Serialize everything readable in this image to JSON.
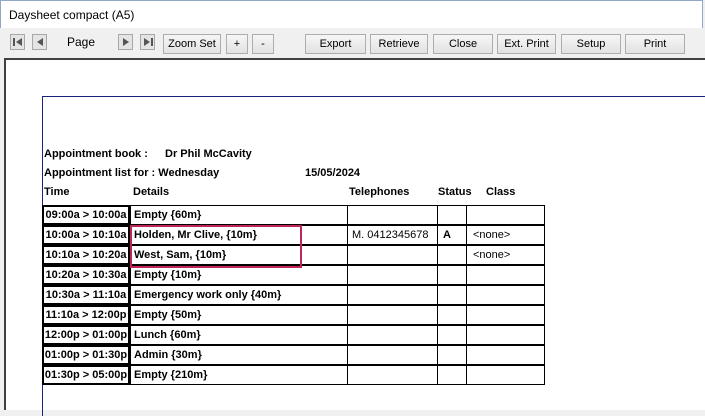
{
  "window": {
    "title": "Daysheet compact (A5)"
  },
  "toolbar": {
    "page_label": "Page",
    "zoom_set": "Zoom Set",
    "zoom_in": "+",
    "zoom_out": "-",
    "export": "Export",
    "retrieve": "Retrieve",
    "close": "Close",
    "ext_print": "Ext. Print",
    "setup": "Setup",
    "print": "Print"
  },
  "report": {
    "book_label": "Appointment book :",
    "book_value": "Dr Phil McCavity",
    "list_label": "Appointment list for : Wednesday",
    "date": "15/05/2024",
    "headers": {
      "time": "Time",
      "details": "Details",
      "telephones": "Telephones",
      "status": "Status",
      "class": "Class"
    },
    "rows": [
      {
        "time": "09:00a > 10:00a",
        "details": "Empty {60m}",
        "telephone": "",
        "status": "",
        "class": ""
      },
      {
        "time": "10:00a > 10:10a",
        "details": "Holden, Mr Clive,  {10m}",
        "telephone": "M. 0412345678",
        "status": "A",
        "class": "<none>"
      },
      {
        "time": "10:10a > 10:20a",
        "details": "West, Sam,  {10m}",
        "telephone": "",
        "status": "",
        "class": "<none>"
      },
      {
        "time": "10:20a > 10:30a",
        "details": "Empty {10m}",
        "telephone": "",
        "status": "",
        "class": ""
      },
      {
        "time": "10:30a > 11:10a",
        "details": "Emergency work only {40m}",
        "telephone": "",
        "status": "",
        "class": ""
      },
      {
        "time": "11:10a > 12:00p",
        "details": "Empty {50m}",
        "telephone": "",
        "status": "",
        "class": ""
      },
      {
        "time": "12:00p > 01:00p",
        "details": "Lunch {60m}",
        "telephone": "",
        "status": "",
        "class": ""
      },
      {
        "time": "01:00p > 01:30p",
        "details": "Admin {30m}",
        "telephone": "",
        "status": "",
        "class": ""
      },
      {
        "time": "01:30p > 05:00p",
        "details": "Empty {210m}",
        "telephone": "",
        "status": "",
        "class": ""
      }
    ]
  },
  "colors": {
    "highlight": "#c0245a",
    "page_border": "#1a237e"
  },
  "icons": [
    "first-page-icon",
    "previous-page-icon",
    "next-page-icon",
    "last-page-icon"
  ]
}
